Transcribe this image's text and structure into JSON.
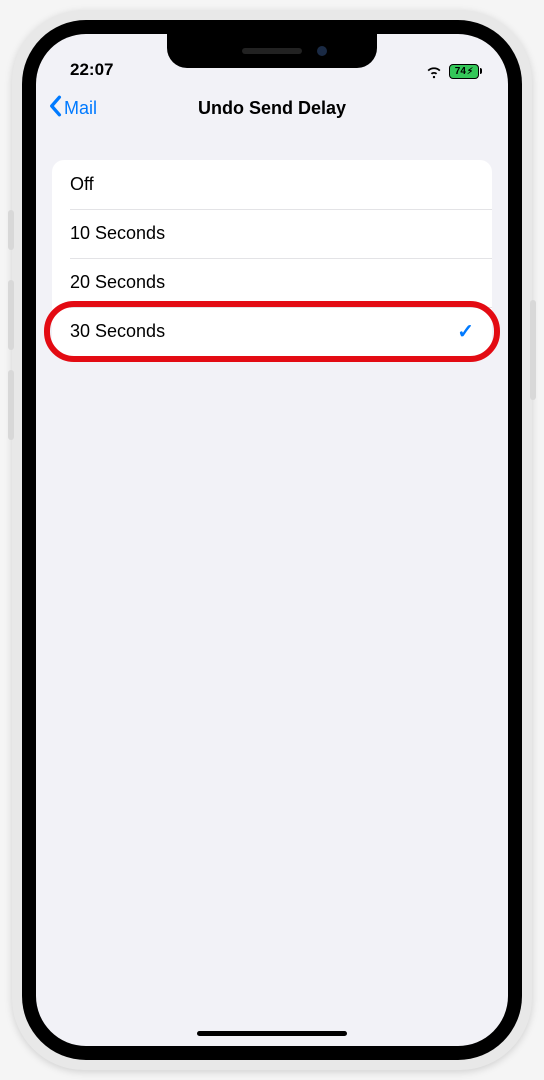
{
  "status": {
    "time": "22:07",
    "battery_pct": "74",
    "battery_charging": true
  },
  "nav": {
    "back_label": "Mail",
    "title": "Undo Send Delay"
  },
  "options": [
    {
      "label": "Off",
      "selected": false
    },
    {
      "label": "10 Seconds",
      "selected": false
    },
    {
      "label": "20 Seconds",
      "selected": false
    },
    {
      "label": "30 Seconds",
      "selected": true
    }
  ],
  "annotation": {
    "highlighted_index": 3
  },
  "colors": {
    "accent": "#007aff",
    "battery_green": "#34c759",
    "highlight": "#e30b13",
    "bg": "#f2f2f7"
  }
}
